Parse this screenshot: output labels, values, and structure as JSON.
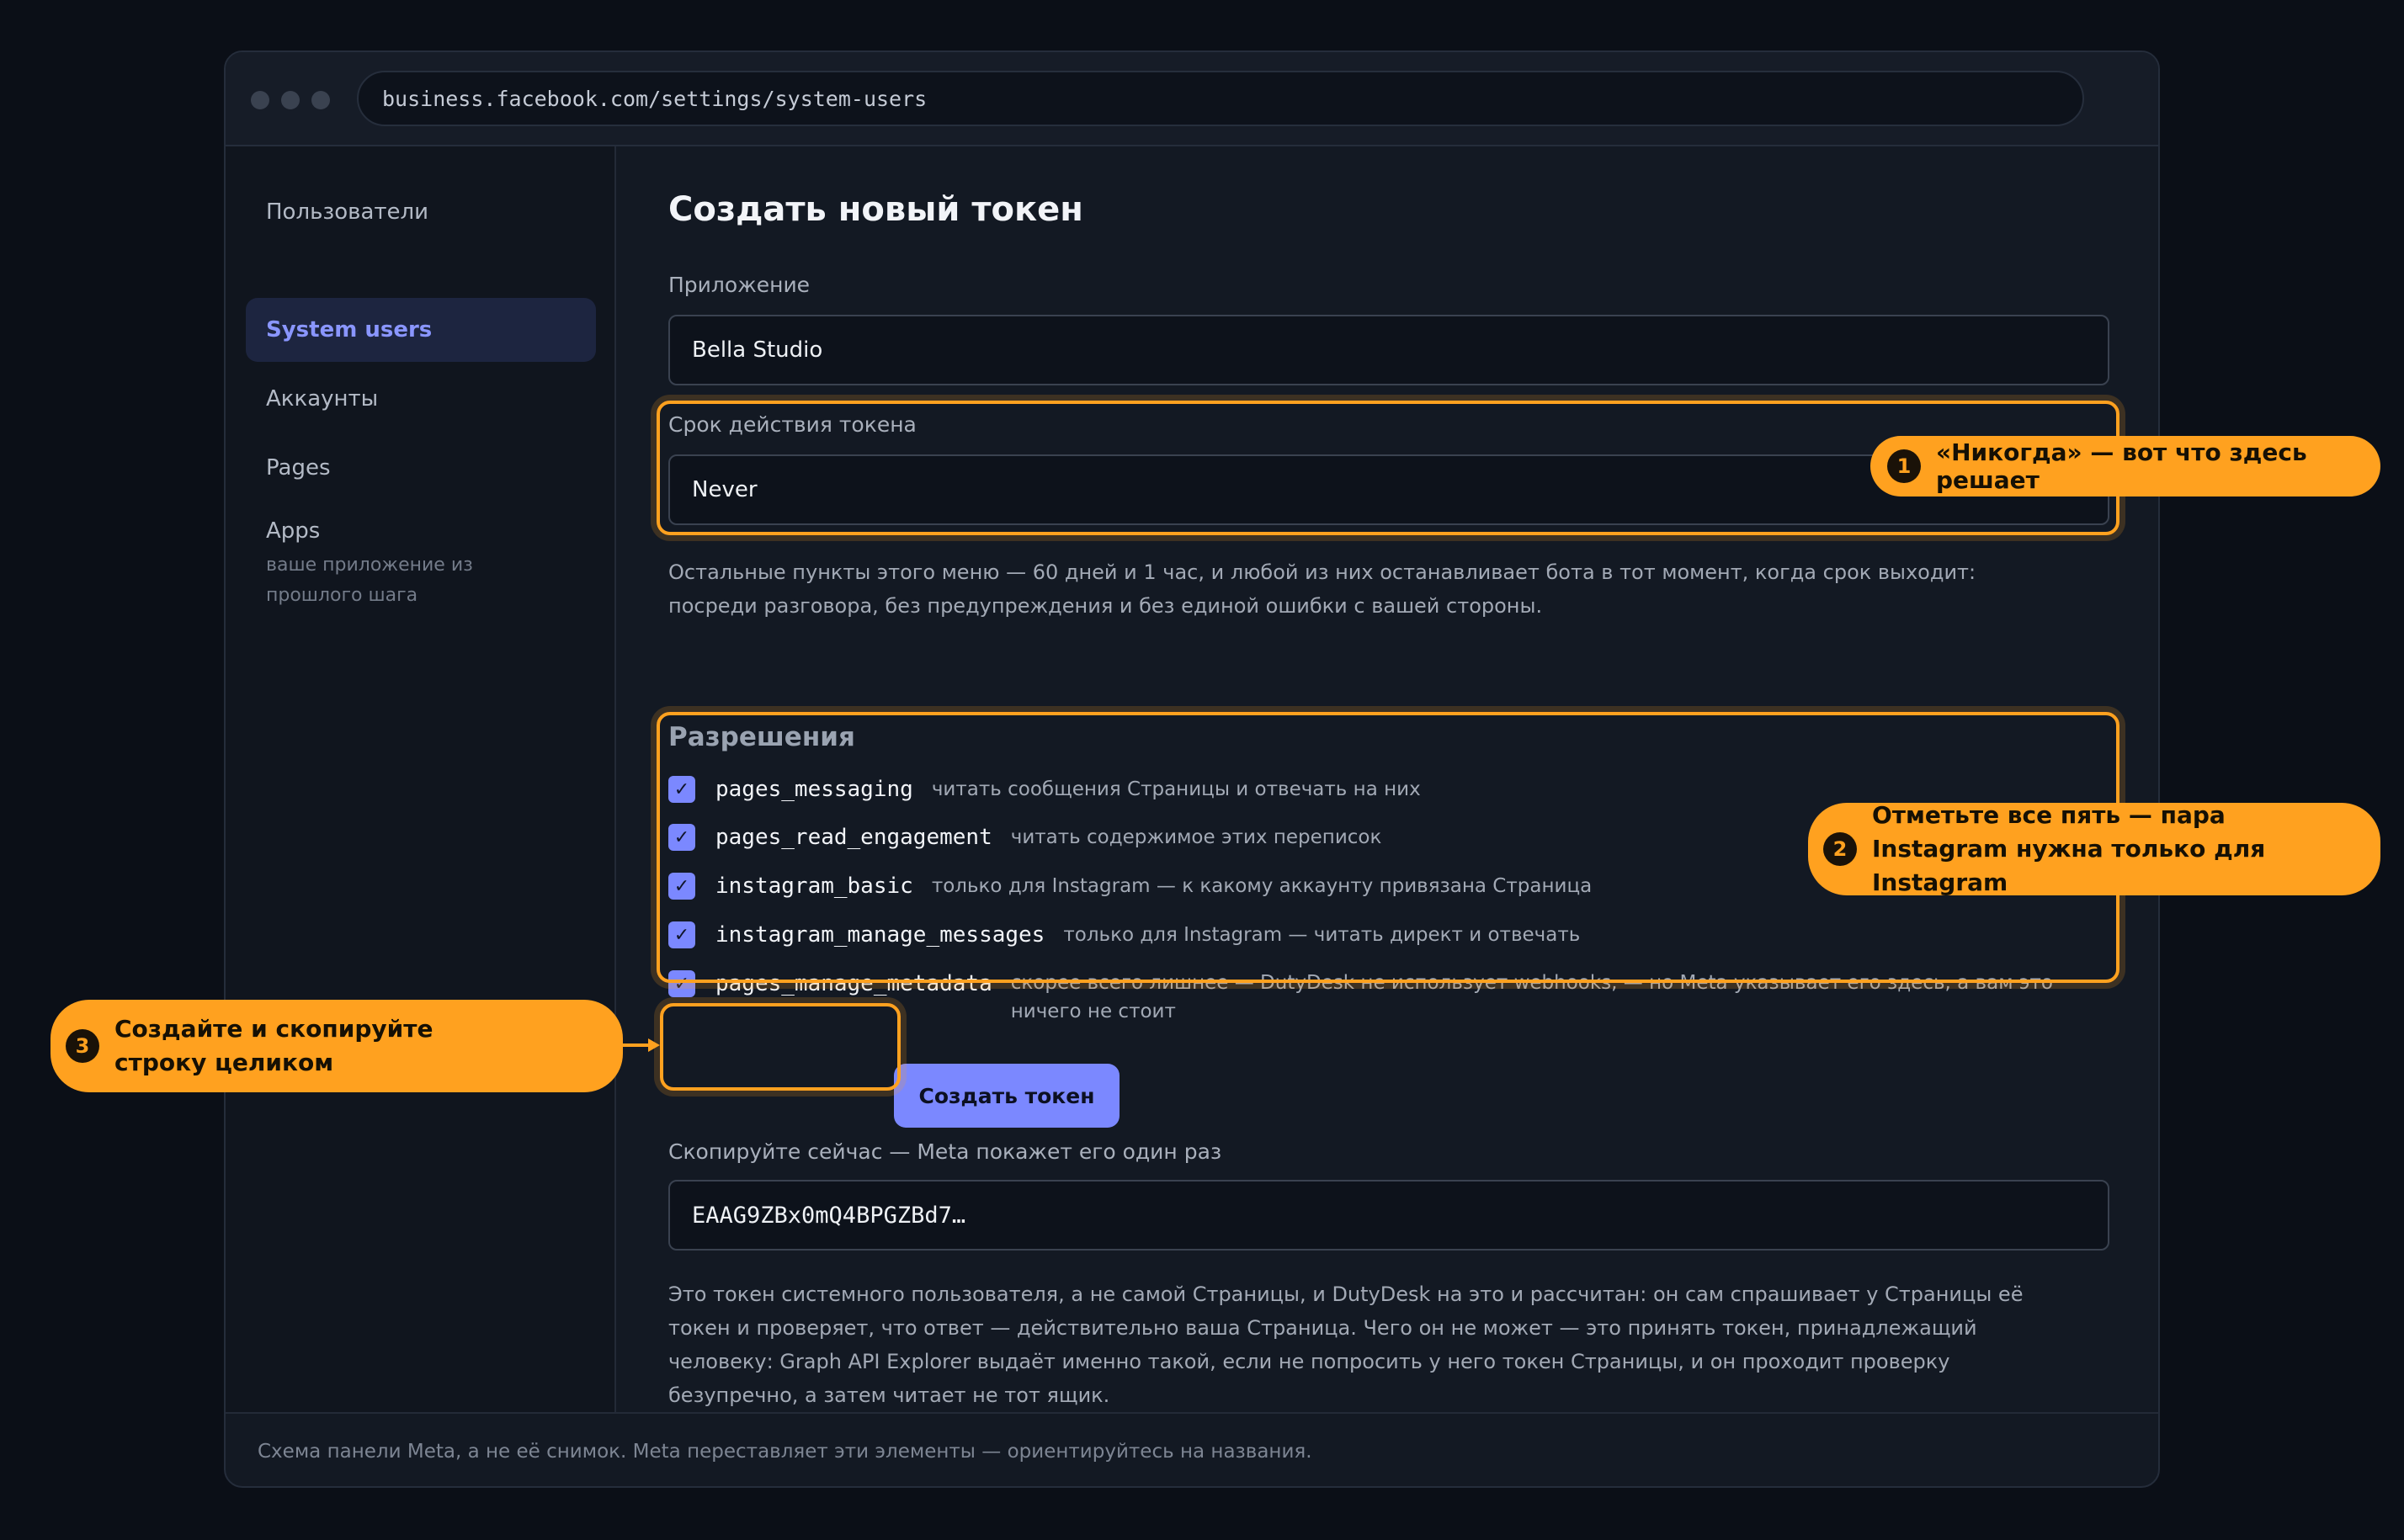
{
  "browser": {
    "url": "business.facebook.com/settings/system-users"
  },
  "sidebar": {
    "items": [
      {
        "label": "Пользователи"
      },
      {
        "label": "System users"
      },
      {
        "label": "Аккаунты"
      },
      {
        "label": "Pages"
      },
      {
        "label": "Apps",
        "sublabel": "ваше приложение из прошлого шага"
      }
    ]
  },
  "main": {
    "title": "Создать новый токен",
    "app_label": "Приложение",
    "app_value": "Bella Studio",
    "expiry_label": "Срок действия токена",
    "expiry_value": "Never",
    "expiry_hint": "Остальные пункты этого меню — 60 дней и 1 час, и любой из них останавливает бота в тот момент, когда срок выходит: посреди разговора, без предупреждения и без единой ошибки с вашей стороны.",
    "permissions_title": "Разрешения",
    "permissions": [
      {
        "code": "pages_messaging",
        "desc": "читать сообщения Страницы и отвечать на них",
        "checked": true
      },
      {
        "code": "pages_read_engagement",
        "desc": "читать содержимое этих переписок",
        "checked": true
      },
      {
        "code": "instagram_basic",
        "desc": "только для Instagram — к какому аккаунту привязана Страница",
        "checked": true
      },
      {
        "code": "instagram_manage_messages",
        "desc": "только для Instagram — читать директ и отвечать",
        "checked": true
      },
      {
        "code": "pages_manage_metadata",
        "desc": "скорее всего лишнее — DutyDesk не использует webhooks, — но Meta указывает его здесь, а вам это ничего не стоит",
        "checked": true
      }
    ],
    "create_button": "Создать токен",
    "copy_label": "Скопируйте сейчас — Meta покажет его один раз",
    "token_value": "EAAG9ZBx0mQ4BPGZBd7…",
    "token_note": "Это токен системного пользователя, а не самой Страницы, и DutyDesk на это и рассчитан: он сам спрашивает у Страницы её токен и проверяет, что ответ — действительно ваша Страница. Чего он не может — это принять токен, принадлежащий человеку: Graph API Explorer выдаёт именно такой, если не попросить у него токен Страницы, и он проходит проверку безупречно, а затем читает не тот ящик."
  },
  "footer": {
    "text": "Схема панели Meta, а не её снимок. Meta переставляет эти элементы — ориентируйтесь на названия."
  },
  "callouts": [
    {
      "num": "1",
      "text": "«Никогда» — вот что здесь решает"
    },
    {
      "num": "2",
      "text": "Отметьте все пять — пара Instagram нужна только для Instagram"
    },
    {
      "num": "3",
      "text": "Создайте и скопируйте строку целиком"
    }
  ],
  "colors": {
    "accent": "#7b88ff",
    "highlight": "#ffa11f",
    "background": "#0b0f17"
  }
}
